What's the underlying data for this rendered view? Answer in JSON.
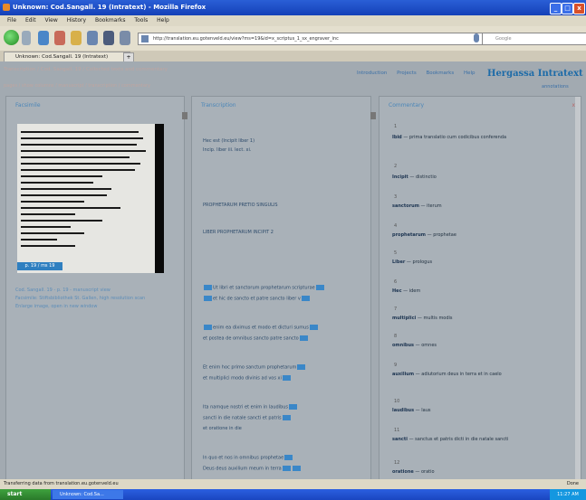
{
  "window": {
    "title": "Unknown: Cod.Sangall. 19 (Intratext) - Mozilla Firefox",
    "min_label": "_",
    "max_label": "□",
    "close_label": "x"
  },
  "menu": {
    "items": [
      "File",
      "Edit",
      "View",
      "History",
      "Bookmarks",
      "Tools",
      "Help"
    ]
  },
  "toolbar": {
    "url": "http://translation.eu.gotenveld.eu/view?ms=19&id=x_scriptus_1_sx_engraver_inc",
    "search_placeholder": "Google"
  },
  "tab": {
    "label": "Unknown: Cod.Sangall. 19 (Intratext)",
    "close": "x"
  },
  "header": {
    "breadcrumb": "Transcription / Cod. Sangall. 19 / Collected texts and commentary",
    "sublinks": "pages / show columns / manuscript / transcription / commentary",
    "links": [
      "Introduction",
      "Projects",
      "Bookmarks",
      "Help"
    ],
    "brand": "Hergassa Intratext",
    "brand_sub": "annotations"
  },
  "columns": {
    "left_title": "Facsimile",
    "mid_title": "Transcription",
    "right_title": "Commentary",
    "right_tool": "x"
  },
  "facsimile": {
    "page_label": "p. 19 / ms 19",
    "caption_lines": [
      "Cod. Sangall. 19 - p. 19 - manuscript view",
      "Facsimile: Stiftsbibliothek St. Gallen, high resolution scan",
      "Enlarge image, open in new window"
    ]
  },
  "transcription": {
    "lines": [
      "Hec est (Incipit liber 1)",
      "Incip. liber iii. lect. xi.",
      "PROPHETARUM PRETIO SINGULIS",
      "LIBER PROPHETARUM INCIPIT 2",
      "Ut libri et sanctorum prophetarum scripturae",
      "et hic de sancto et patre sancto liber v",
      "enim ea diximus et modo et dicturi sumus",
      "et postea de omnibus sancto patre sancto",
      "Et enim hoc primo sanctum prophetarum",
      "et multiplici modo divinis ad vos xi",
      "Ita namque nostri et enim in laudibus",
      "sancti in die natale sancti et patris",
      "et oratione in die",
      "In quo et nos in omnibus prophetae",
      "Deus deus auxilium meum in terra"
    ]
  },
  "commentary": {
    "entries": [
      {
        "num": "1",
        "word": "Ibid",
        "gloss": "prima translatio cum codicibus conferenda"
      },
      {
        "num": "2",
        "word": "Incipit",
        "gloss": "distinctio"
      },
      {
        "num": "3",
        "word": "sanctorum",
        "gloss": "iterum"
      },
      {
        "num": "4",
        "word": "prophetarum",
        "gloss": "prophetae"
      },
      {
        "num": "5",
        "word": "Liber",
        "gloss": "prologus"
      },
      {
        "num": "6",
        "word": "Hec",
        "gloss": "idem"
      },
      {
        "num": "7",
        "word": "multiplici",
        "gloss": "multis modis"
      },
      {
        "num": "8",
        "word": "omnibus",
        "gloss": "omnes"
      },
      {
        "num": "9",
        "word": "auxilium",
        "gloss": "adiutorium deus in terra et in caelo"
      },
      {
        "num": "10",
        "word": "laudibus",
        "gloss": "laus"
      },
      {
        "num": "11",
        "word": "sancti",
        "gloss": "sanctus et patris dicti in die natale sancti"
      },
      {
        "num": "12",
        "word": "oratione",
        "gloss": "oratio"
      }
    ]
  },
  "status": {
    "text": "Transferring data from translation.eu.gotenveld.eu",
    "right": "Done"
  },
  "taskbar": {
    "start": "start",
    "task": "Unknown: Cod.Sa...",
    "clock": "11:27 AM"
  }
}
